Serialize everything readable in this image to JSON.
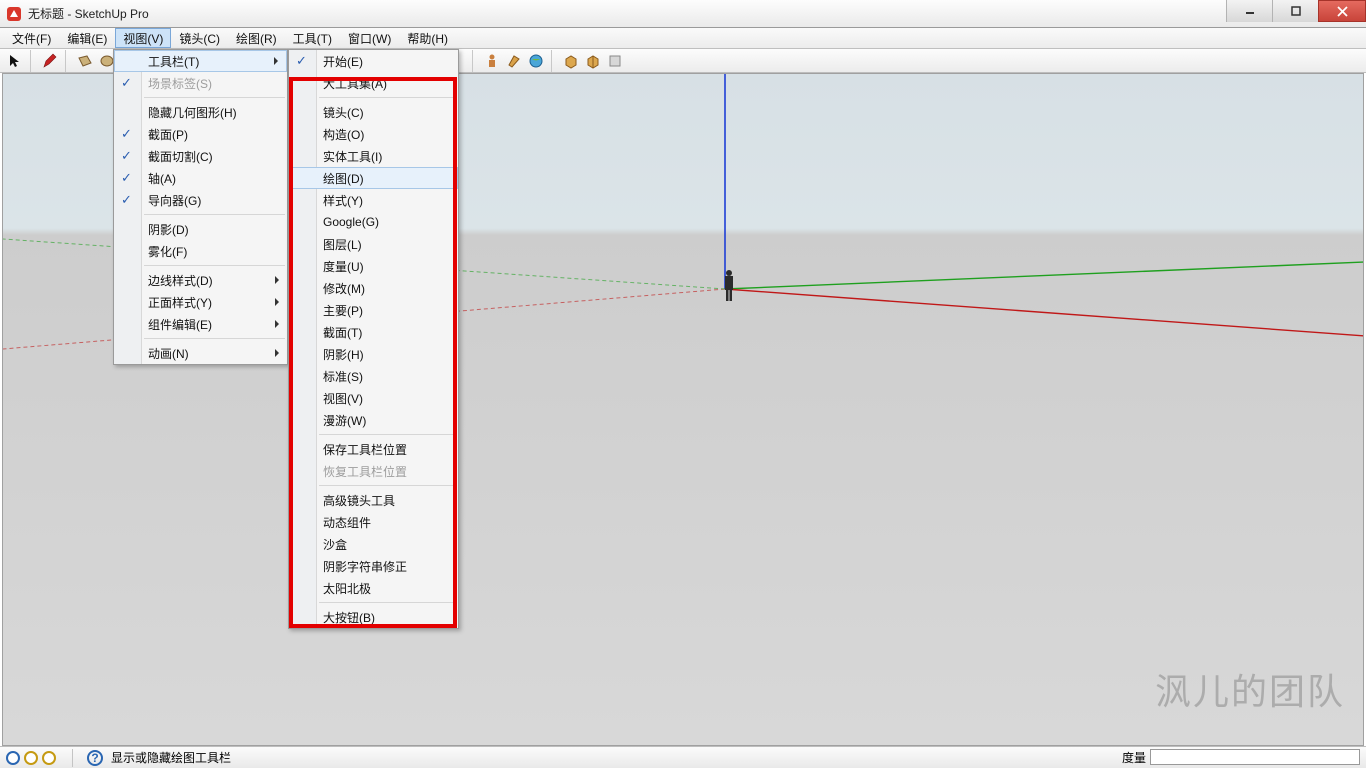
{
  "window": {
    "title": "无标题 - SketchUp Pro"
  },
  "menubar": {
    "items": [
      {
        "label": "文件(F)"
      },
      {
        "label": "编辑(E)"
      },
      {
        "label": "视图(V)",
        "active": true
      },
      {
        "label": "镜头(C)"
      },
      {
        "label": "绘图(R)"
      },
      {
        "label": "工具(T)"
      },
      {
        "label": "窗口(W)"
      },
      {
        "label": "帮助(H)"
      }
    ]
  },
  "dropdown_view": {
    "items": [
      {
        "label": "工具栏(T)",
        "submenu": true,
        "highlight": true
      },
      {
        "label": "场景标签(S)",
        "disabled": true,
        "check": true
      },
      {
        "sep": true
      },
      {
        "label": "隐藏几何图形(H)"
      },
      {
        "label": "截面(P)",
        "check": true
      },
      {
        "label": "截面切割(C)",
        "check": true
      },
      {
        "label": "轴(A)",
        "check": true
      },
      {
        "label": "导向器(G)",
        "check": true
      },
      {
        "sep": true
      },
      {
        "label": "阴影(D)"
      },
      {
        "label": "雾化(F)"
      },
      {
        "sep": true
      },
      {
        "label": "边线样式(D)",
        "submenu": true
      },
      {
        "label": "正面样式(Y)",
        "submenu": true
      },
      {
        "label": "组件编辑(E)",
        "submenu": true
      },
      {
        "sep": true
      },
      {
        "label": "动画(N)",
        "submenu": true
      }
    ]
  },
  "dropdown_toolbars": {
    "items": [
      {
        "label": "开始(E)",
        "check": true
      },
      {
        "label": "大工具集(A)"
      },
      {
        "sep": true
      },
      {
        "label": "镜头(C)"
      },
      {
        "label": "构造(O)"
      },
      {
        "label": "实体工具(I)"
      },
      {
        "label": "绘图(D)",
        "highlight": true
      },
      {
        "label": "样式(Y)"
      },
      {
        "label": "Google(G)"
      },
      {
        "label": "图层(L)"
      },
      {
        "label": "度量(U)"
      },
      {
        "label": "修改(M)"
      },
      {
        "label": "主要(P)"
      },
      {
        "label": "截面(T)"
      },
      {
        "label": "阴影(H)"
      },
      {
        "label": "标准(S)"
      },
      {
        "label": "视图(V)"
      },
      {
        "label": "漫游(W)"
      },
      {
        "sep": true
      },
      {
        "label": "保存工具栏位置"
      },
      {
        "label": "恢复工具栏位置",
        "disabled": true
      },
      {
        "sep": true
      },
      {
        "label": "高级镜头工具"
      },
      {
        "label": "动态组件"
      },
      {
        "label": "沙盒"
      },
      {
        "label": "阴影字符串修正"
      },
      {
        "label": "太阳北极"
      },
      {
        "sep": true
      },
      {
        "label": "大按钮(B)"
      }
    ]
  },
  "status": {
    "text": "显示或隐藏绘图工具栏",
    "dim_label": "度量"
  },
  "watermark": "沨儿的团队",
  "colors": {
    "axis_blue": "#1f3fd6",
    "axis_red": "#c01818",
    "axis_green": "#1fa01f"
  }
}
